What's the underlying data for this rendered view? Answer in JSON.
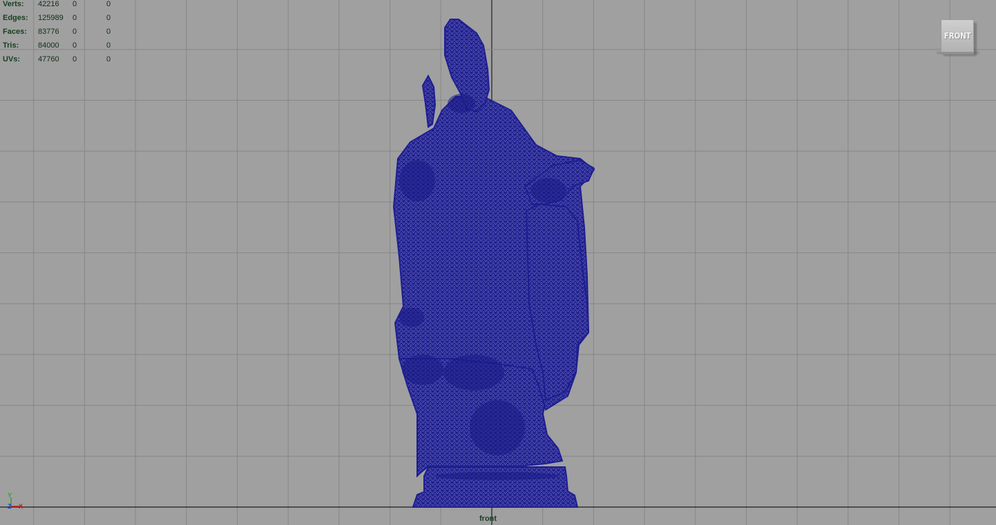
{
  "hud": {
    "rows": [
      {
        "label": "Verts:",
        "c1": "42216",
        "c2": "0",
        "c3": "0"
      },
      {
        "label": "Edges:",
        "c1": "125989",
        "c2": "0",
        "c3": "0"
      },
      {
        "label": "Faces:",
        "c1": "83776",
        "c2": "0",
        "c3": "0"
      },
      {
        "label": "Tris:",
        "c1": "84000",
        "c2": "0",
        "c3": "0"
      },
      {
        "label": "UVs:",
        "c1": "47760",
        "c2": "0",
        "c3": "0"
      }
    ]
  },
  "view_cube": {
    "label": "FRONT"
  },
  "camera": {
    "name": "front"
  },
  "axis": {
    "y": "Y",
    "z": "Z",
    "x": "X"
  },
  "colors": {
    "viewport_bg": "#a0a0a0",
    "grid_line": "#868686",
    "grid_axis": "#1e1e1e",
    "wireframe": "#1a1a8c",
    "hud_text": "#153f1e"
  },
  "icons": {
    "gizmo": "axis-gizmo-icon",
    "mesh": "statue-wireframe-mesh"
  }
}
